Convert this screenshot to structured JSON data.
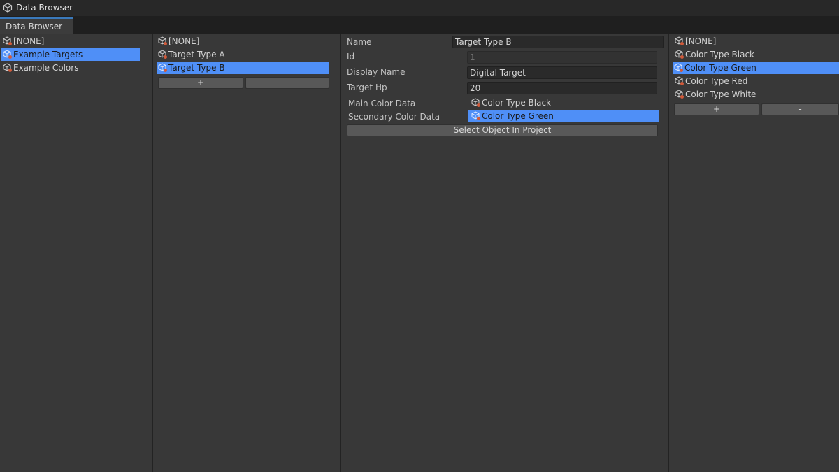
{
  "window": {
    "title": "Data Browser",
    "tab_label": "Data Browser"
  },
  "categories": {
    "items": [
      {
        "label": "[NONE]",
        "selected": false
      },
      {
        "label": "Example Targets",
        "selected": true
      },
      {
        "label": "Example Colors",
        "selected": false
      }
    ]
  },
  "targets": {
    "items": [
      {
        "label": "[NONE]",
        "selected": false
      },
      {
        "label": "Target Type A",
        "selected": false
      },
      {
        "label": "Target Type B",
        "selected": true
      }
    ],
    "add_label": "+",
    "remove_label": "-"
  },
  "inspector": {
    "name_label": "Name",
    "name_value": "Target Type B",
    "id_label": "Id",
    "id_value": "1",
    "display_name_label": "Display Name",
    "display_name_value": "Digital Target",
    "target_hp_label": "Target Hp",
    "target_hp_value": "20",
    "main_color_label": "Main Color Data",
    "main_color_value": "Color Type Black",
    "secondary_color_label": "Secondary Color Data",
    "secondary_color_value": "Color Type Green",
    "select_button_label": "Select Object In Project"
  },
  "colors": {
    "items": [
      {
        "label": "[NONE]",
        "selected": false
      },
      {
        "label": "Color Type Black",
        "selected": false
      },
      {
        "label": "Color Type Green",
        "selected": true
      },
      {
        "label": "Color Type Red",
        "selected": false
      },
      {
        "label": "Color Type White",
        "selected": false
      }
    ],
    "add_label": "+",
    "remove_label": "-"
  },
  "icons": {
    "app": "scriptable-object-icon",
    "item": "scriptable-object-icon"
  },
  "theme": {
    "selection": "#4f8ff7",
    "background": "#383838",
    "titlebar": "#282828",
    "tab_accent": "#3a79bb"
  }
}
